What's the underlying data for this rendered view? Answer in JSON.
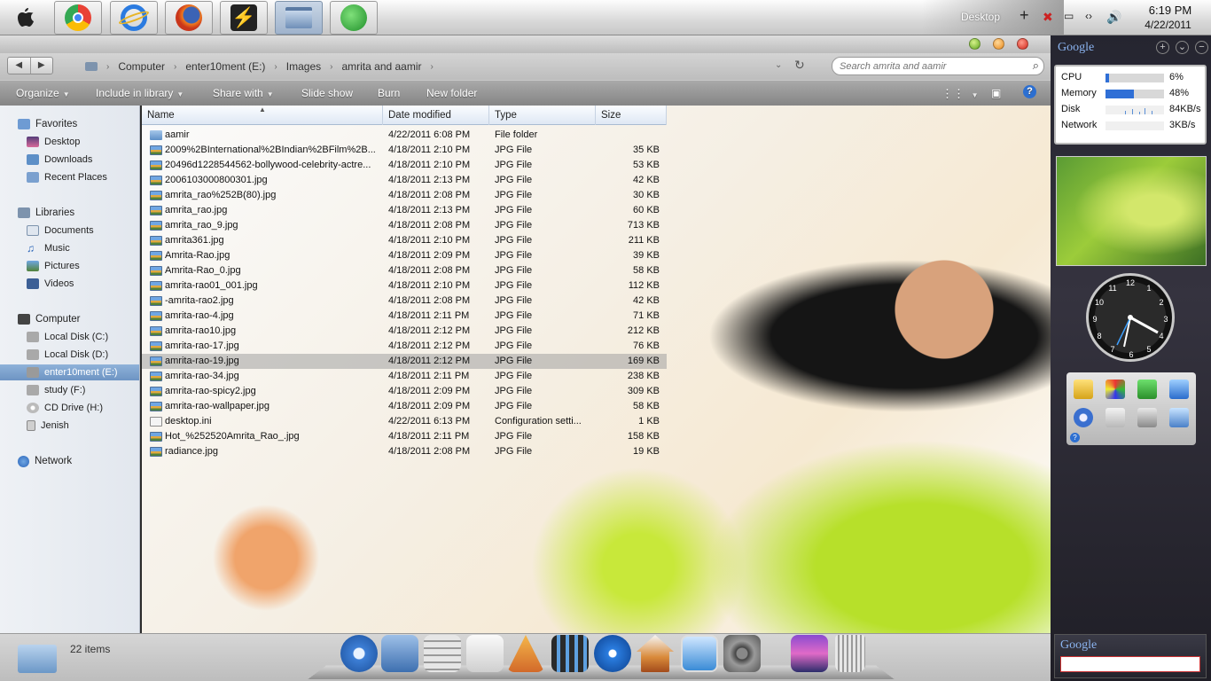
{
  "taskbar": {
    "apps": [
      {
        "name": "apple",
        "icon": "apple-icon"
      },
      {
        "name": "chrome",
        "icon": "chrome-icon"
      },
      {
        "name": "internet-explorer",
        "icon": "ie-icon"
      },
      {
        "name": "firefox",
        "icon": "firefox-icon"
      },
      {
        "name": "winamp",
        "icon": "winamp-icon"
      },
      {
        "name": "libraries",
        "icon": "library-icon"
      },
      {
        "name": "update",
        "icon": "update-icon"
      }
    ],
    "desktop_label": "Desktop",
    "time": "6:19 PM",
    "date": "4/22/2011"
  },
  "window": {
    "breadcrumb": [
      "Computer",
      "enter10ment (E:)",
      "Images",
      "amrita and aamir"
    ],
    "search_placeholder": "Search amrita and aamir",
    "toolbar": {
      "organize": "Organize",
      "include": "Include in library",
      "share": "Share with",
      "slideshow": "Slide show",
      "burn": "Burn",
      "new_folder": "New folder"
    },
    "nav": {
      "favorites": "Favorites",
      "desktop": "Desktop",
      "downloads": "Downloads",
      "recent": "Recent Places",
      "libraries": "Libraries",
      "documents": "Documents",
      "music": "Music",
      "pictures": "Pictures",
      "videos": "Videos",
      "computer": "Computer",
      "disk_c": "Local Disk (C:)",
      "disk_d": "Local Disk (D:)",
      "disk_e": "enter10ment (E:)",
      "study": "study (F:)",
      "cd": "CD Drive (H:)",
      "jenish": "Jenish",
      "network": "Network"
    },
    "columns": {
      "name": "Name",
      "date": "Date modified",
      "type": "Type",
      "size": "Size"
    },
    "files": [
      {
        "name": "aamir",
        "date": "4/22/2011 6:08 PM",
        "type": "File folder",
        "size": ""
      },
      {
        "name": "2009%2BInternational%2BIndian%2BFilm%2B...",
        "date": "4/18/2011 2:10 PM",
        "type": "JPG File",
        "size": "35 KB"
      },
      {
        "name": "20496d1228544562-bollywood-celebrity-actre...",
        "date": "4/18/2011 2:10 PM",
        "type": "JPG File",
        "size": "53 KB"
      },
      {
        "name": "2006103000800301.jpg",
        "date": "4/18/2011 2:13 PM",
        "type": "JPG File",
        "size": "42 KB"
      },
      {
        "name": "amrita_rao%252B(80).jpg",
        "date": "4/18/2011 2:08 PM",
        "type": "JPG File",
        "size": "30 KB"
      },
      {
        "name": "amrita_rao.jpg",
        "date": "4/18/2011 2:13 PM",
        "type": "JPG File",
        "size": "60 KB"
      },
      {
        "name": "amrita_rao_9.jpg",
        "date": "4/18/2011 2:08 PM",
        "type": "JPG File",
        "size": "713 KB"
      },
      {
        "name": "amrita361.jpg",
        "date": "4/18/2011 2:10 PM",
        "type": "JPG File",
        "size": "211 KB"
      },
      {
        "name": "Amrita-Rao.jpg",
        "date": "4/18/2011 2:09 PM",
        "type": "JPG File",
        "size": "39 KB"
      },
      {
        "name": "Amrita-Rao_0.jpg",
        "date": "4/18/2011 2:08 PM",
        "type": "JPG File",
        "size": "58 KB"
      },
      {
        "name": "amrita-rao01_001.jpg",
        "date": "4/18/2011 2:10 PM",
        "type": "JPG File",
        "size": "112 KB"
      },
      {
        "name": "-amrita-rao2.jpg",
        "date": "4/18/2011 2:08 PM",
        "type": "JPG File",
        "size": "42 KB"
      },
      {
        "name": "amrita-rao-4.jpg",
        "date": "4/18/2011 2:11 PM",
        "type": "JPG File",
        "size": "71 KB"
      },
      {
        "name": "amrita-rao10.jpg",
        "date": "4/18/2011 2:12 PM",
        "type": "JPG File",
        "size": "212 KB"
      },
      {
        "name": "amrita-rao-17.jpg",
        "date": "4/18/2011 2:12 PM",
        "type": "JPG File",
        "size": "76 KB"
      },
      {
        "name": "amrita-rao-19.jpg",
        "date": "4/18/2011 2:12 PM",
        "type": "JPG File",
        "size": "169 KB"
      },
      {
        "name": "amrita-rao-34.jpg",
        "date": "4/18/2011 2:11 PM",
        "type": "JPG File",
        "size": "238 KB"
      },
      {
        "name": "amrita-rao-spicy2.jpg",
        "date": "4/18/2011 2:09 PM",
        "type": "JPG File",
        "size": "309 KB"
      },
      {
        "name": "amrita-rao-wallpaper.jpg",
        "date": "4/18/2011 2:09 PM",
        "type": "JPG File",
        "size": "58 KB"
      },
      {
        "name": "desktop.ini",
        "date": "4/22/2011 6:13 PM",
        "type": "Configuration setti...",
        "size": "1 KB"
      },
      {
        "name": "Hot_%252520Amrita_Rao_.jpg",
        "date": "4/18/2011 2:11 PM",
        "type": "JPG File",
        "size": "158 KB"
      },
      {
        "name": "radiance.jpg",
        "date": "4/18/2011 2:08 PM",
        "type": "JPG File",
        "size": "19 KB"
      }
    ],
    "selected_index": 15,
    "status": "22 items"
  },
  "sidebar": {
    "logo": "Google",
    "sysmon": [
      {
        "label": "CPU",
        "value": "6%",
        "level": 0.06
      },
      {
        "label": "Memory",
        "value": "48%",
        "level": 0.48
      },
      {
        "label": "Disk",
        "value": "84KB/s",
        "level": 0.0
      },
      {
        "label": "Network",
        "value": "3KB/s",
        "level": 0.0
      }
    ],
    "search_logo": "Google"
  },
  "colors": {
    "accent": "#6d94c3",
    "bar": "#2f6fd6"
  }
}
